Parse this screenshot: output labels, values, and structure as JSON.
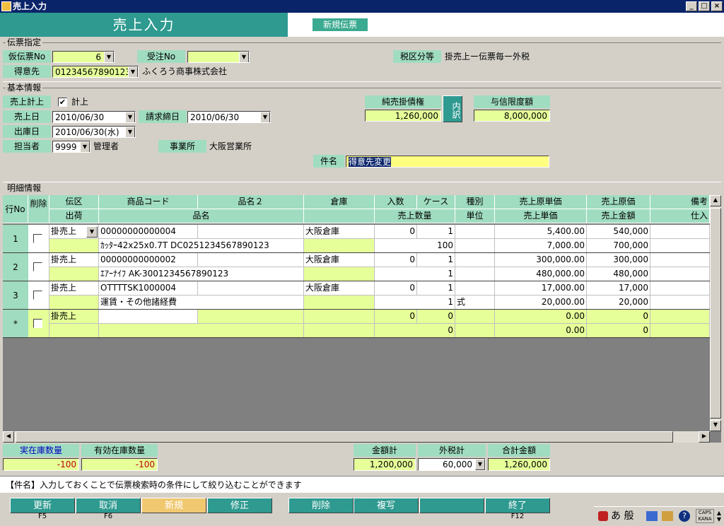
{
  "window": {
    "title": "売上入力",
    "controls": [
      "_",
      "□",
      "×"
    ]
  },
  "header": {
    "title": "売上入力",
    "new_badge": "新規伝票"
  },
  "denpyo": {
    "section": "伝票指定",
    "kari_no_label": "仮伝票No",
    "kari_no_value": "6",
    "juchu_label": "受注No",
    "juchu_value": "",
    "tax_label": "税区分等",
    "tax_value": "掛売上ー伝票毎ー外税",
    "tokui_label": "得意先",
    "tokui_code": "01234567890123",
    "tokui_name": "ふくろう商事株式会社"
  },
  "kihon": {
    "section": "基本情報",
    "keijo_label": "売上計上",
    "keijo_check": "✔",
    "keijo_text": "計上",
    "uriage_label": "売上日",
    "uriage_value": "2010/06/30",
    "seikyu_label": "請求締日",
    "seikyu_value": "2010/06/30",
    "shukko_label": "出庫日",
    "shukko_value": "2010/06/30(水)",
    "tanto_label": "担当者",
    "tanto_code": "9999",
    "tanto_name": "管理者",
    "jimusho_label": "事業所",
    "jimusho_value": "大阪営業所",
    "kenmei_label": "件名",
    "kenmei_value": "得意先変更",
    "junkake_label": "純売掛債権",
    "junkake_value": "1,260,000",
    "uchiwake_label": "内訳",
    "yoshin_label": "与信限度額",
    "yoshin_value": "8,000,000"
  },
  "meisai": {
    "section": "明細情報",
    "headers_top": [
      "伝区",
      "商品コード",
      "品名２",
      "倉庫",
      "入数",
      "ケース",
      "種別",
      "売上原単価",
      "売上原価",
      "備考"
    ],
    "headers_bottom": [
      "出荷",
      "品名",
      "",
      "売上数量",
      "単位",
      "売上単価",
      "売上金額",
      "仕入"
    ],
    "rowno_header": "行No",
    "delete_header": "削除",
    "rows": [
      {
        "no": "1",
        "denku": "掛売上",
        "code": "00000000000004",
        "hinmei2": "",
        "soko": "大阪倉庫",
        "irisu": "0",
        "case": "1",
        "shubetsu": "",
        "gen_tanka": "5,400.00",
        "genka": "540,000",
        "hinmei": "ｶｯﾀｰ42x25x0.7T DC0251234567890123",
        "suryo": "100",
        "tani": "",
        "tanka": "7,000.00",
        "kingaku": "700,000"
      },
      {
        "no": "2",
        "denku": "掛売上",
        "code": "00000000000002",
        "hinmei2": "",
        "soko": "大阪倉庫",
        "irisu": "0",
        "case": "1",
        "shubetsu": "",
        "gen_tanka": "300,000.00",
        "genka": "300,000",
        "hinmei": "ｴｱｰﾅｲﾌ AK-3001234567890123",
        "suryo": "1",
        "tani": "",
        "tanka": "480,000.00",
        "kingaku": "480,000"
      },
      {
        "no": "3",
        "denku": "掛売上",
        "code": "OTTTTSK1000004",
        "hinmei2": "",
        "soko": "大阪倉庫",
        "irisu": "0",
        "case": "1",
        "shubetsu": "",
        "gen_tanka": "17,000.00",
        "genka": "17,000",
        "hinmei": "運賃・その他諸経費",
        "suryo": "1",
        "tani": "式",
        "tanka": "20,000.00",
        "kingaku": "20,000"
      },
      {
        "no": "*",
        "denku": "掛売上",
        "code": "",
        "hinmei2": "",
        "soko": "",
        "irisu": "0",
        "case": "0",
        "shubetsu": "",
        "gen_tanka": "0.00",
        "genka": "0",
        "hinmei": "",
        "suryo": "0",
        "tani": "",
        "tanka": "0.00",
        "kingaku": "0"
      }
    ]
  },
  "stock": {
    "jitsu_label": "実在庫数量",
    "jitsu_value": "-100",
    "yuko_label": "有効在庫数量",
    "yuko_value": "-100"
  },
  "totals": {
    "kingaku_label": "金額計",
    "kingaku_value": "1,200,000",
    "sotozei_label": "外税計",
    "sotozei_value": "60,000",
    "gokei_label": "合計金額",
    "gokei_value": "1,260,000"
  },
  "hint": "【件名】入力しておくことで伝票検索時の条件にして絞り込むことができます",
  "buttons": [
    {
      "label": "更新",
      "key": "F5"
    },
    {
      "label": "取消",
      "key": "F6"
    },
    {
      "label": "新規",
      "key": ""
    },
    {
      "label": "修正",
      "key": ""
    },
    {
      "label": "削除",
      "key": ""
    },
    {
      "label": "複写",
      "key": ""
    },
    {
      "label": "",
      "key": ""
    },
    {
      "label": "終了",
      "key": "F12"
    }
  ],
  "tray": {
    "ime": "あ 般",
    "caps": "CAPS KANA"
  }
}
